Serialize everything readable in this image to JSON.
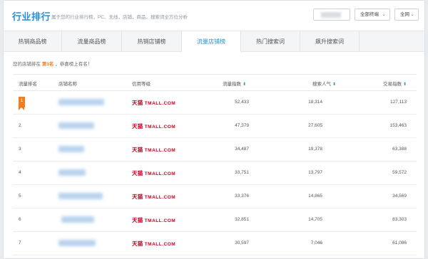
{
  "header": {
    "title": "行业排行",
    "subtitle": "属于您的行业排行榜，PC、无线，店铺，商品，搜索词全方位分析",
    "terminal_filter": "全部终端",
    "region_filter": "全网"
  },
  "tabs": [
    {
      "label": "热销商品榜"
    },
    {
      "label": "流量商品榜"
    },
    {
      "label": "热销店铺榜"
    },
    {
      "label": "流量店铺榜",
      "active": true
    },
    {
      "label": "热门搜索词"
    },
    {
      "label": "飙升搜索词"
    }
  ],
  "notice": {
    "prefix": "您的店铺排在",
    "rank": "第1名",
    "suffix": "，恭喜榜上有名！"
  },
  "table": {
    "columns": {
      "rank": "流量排名",
      "name": "店铺名称",
      "credit": "信用等级",
      "traffic": "流量指数",
      "search": "搜索人气",
      "trade": "交易指数"
    },
    "credit_logo": {
      "cn": "天猫",
      "en": "TMALL.COM"
    },
    "rows": [
      {
        "rank": "1",
        "traffic": "52,433",
        "search": "18,314",
        "trade": "127,113"
      },
      {
        "rank": "2",
        "traffic": "47,379",
        "search": "27,605",
        "trade": "153,463"
      },
      {
        "rank": "3",
        "traffic": "34,487",
        "search": "19,378",
        "trade": "63,388"
      },
      {
        "rank": "4",
        "traffic": "33,751",
        "search": "13,797",
        "trade": "59,572"
      },
      {
        "rank": "5",
        "traffic": "33,376",
        "search": "14,865",
        "trade": "34,569"
      },
      {
        "rank": "6",
        "traffic": "32,851",
        "search": "14,705",
        "trade": "83,303"
      },
      {
        "rank": "7",
        "traffic": "30,597",
        "search": "7,046",
        "trade": "61,086"
      }
    ]
  },
  "colors": {
    "accent": "#2b8fd1",
    "rank_badge": "#f07d1e",
    "tmall_red": "#c40022"
  }
}
